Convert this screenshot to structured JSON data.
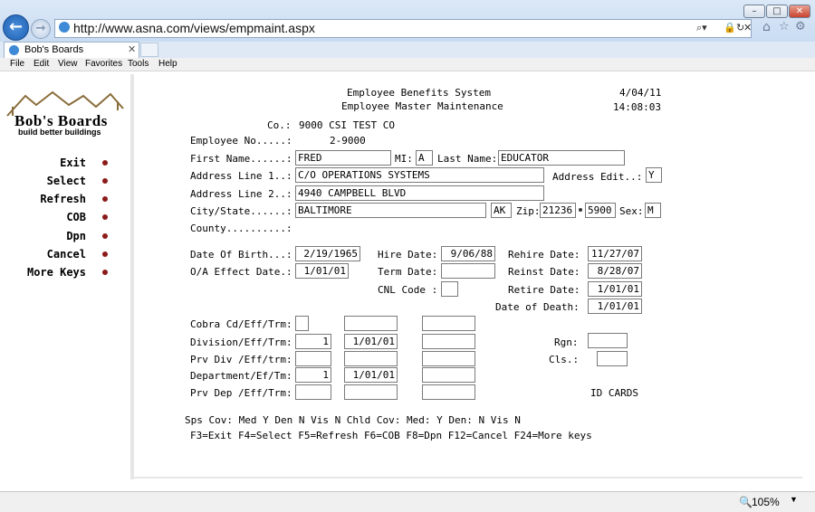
{
  "browser": {
    "url": "http://www.asna.com/views/empmaint.aspx",
    "tab_title": "Bob's Boards",
    "menu": [
      "File",
      "Edit",
      "View",
      "Favorites",
      "Tools",
      "Help"
    ],
    "zoom": "105%"
  },
  "logo": {
    "name": "Bob's Boards",
    "tagline": "build better buildings"
  },
  "sidemenu": [
    "Exit",
    "Select",
    "Refresh",
    "COB",
    "Dpn",
    "Cancel",
    "More Keys"
  ],
  "header": {
    "system": "Employee Benefits System",
    "screen": "Employee Master Maintenance",
    "date": "4/04/11",
    "time": "14:08:03",
    "co_label": "Co.:",
    "co_value": "9000 CSI TEST CO",
    "empno_label": "Employee No.....:",
    "empno_value": "2-9000"
  },
  "labels": {
    "first_name": "First Name......:",
    "mi": "MI:",
    "last_name": "Last Name:",
    "addr1": "Address Line 1..:",
    "addr_edit": "Address Edit..:",
    "addr2": "Address Line 2..:",
    "city_state": "City/State......:",
    "zip": "Zip:",
    "sex": "Sex:",
    "county": "County..........:",
    "dob": "Date Of Birth...:",
    "hire": "Hire Date:",
    "rehire": "Rehire Date:",
    "oa": "O/A Effect Date.:",
    "term": "Term Date:",
    "reinst": "Reinst Date:",
    "cnl": "CNL Code :",
    "retire": "Retire Date:",
    "death": "Date of Death:",
    "cobra": "Cobra Cd/Eff/Trm:",
    "division": "Division/Eff/Trm:",
    "prv_div": "Prv Div /Eff/trm:",
    "department": "Department/Ef/Tm:",
    "prv_dep": "Prv Dep /Eff/Trm:",
    "rgn": "Rgn:",
    "cls": "Cls.:",
    "id_cards": "ID CARDS"
  },
  "fields": {
    "first_name": "FRED",
    "mi": "A",
    "last_name": "EDUCATOR",
    "addr1": "C/O OPERATIONS SYSTEMS",
    "addr_edit": "Y",
    "addr2": "4940 CAMPBELL BLVD",
    "city": "BALTIMORE",
    "state": "AK",
    "zip1": "21236",
    "zip2": "5900",
    "sex": "M",
    "dob": "2/19/1965",
    "hire": "9/06/88",
    "rehire": "11/27/07",
    "oa": "1/01/01",
    "term": "",
    "reinst": "8/28/07",
    "cnl": "",
    "retire": "1/01/01",
    "death": "1/01/01",
    "cobra_cd": "",
    "cobra_eff": "",
    "cobra_trm": "",
    "division": "1",
    "division_eff": "1/01/01",
    "division_trm": "",
    "prv_div": "",
    "prv_div_eff": "",
    "prv_div_trm": "",
    "department": "1",
    "department_eff": "1/01/01",
    "department_trm": "",
    "prv_dep": "",
    "prv_dep_eff": "",
    "prv_dep_trm": "",
    "rgn": "",
    "cls": ""
  },
  "footer": {
    "coverage": "Sps Cov: Med Y  Den N  Vis N  Chld Cov: Med: Y  Den: N  Vis N",
    "fkeys": "F3=Exit    F4=Select    F5=Refresh    F6=COB    F8=Dpn    F12=Cancel    F24=More keys"
  },
  "colors": {
    "menu_dot": "#8b1a1a",
    "chrome": "#dbe8f7"
  }
}
